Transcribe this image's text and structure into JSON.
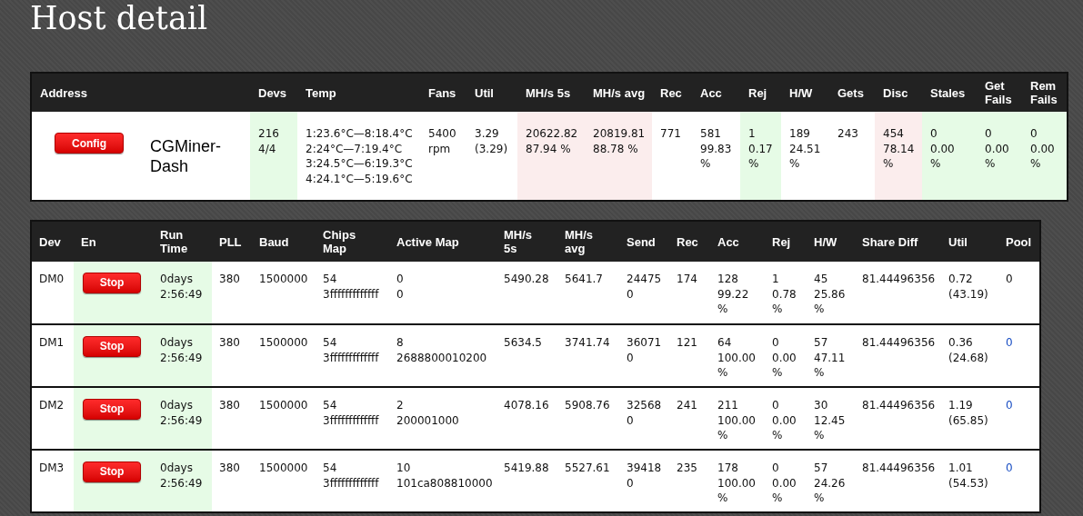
{
  "page": {
    "title": "Host detail"
  },
  "summary_table": {
    "columns": [
      "Address",
      "Devs",
      "Temp",
      "Fans",
      "Util",
      "MH/s 5s",
      "MH/s avg",
      "Rec",
      "Acc",
      "Rej",
      "H/W",
      "Gets",
      "Disc",
      "Stales",
      "Get Fails",
      "Rem Fails"
    ],
    "rows": [
      {
        "cells": [
          {
            "kind": "address",
            "button": "Config",
            "name": "CGMiner-\nDash"
          },
          {
            "kind": "text",
            "text": "216\n4/4",
            "color": "#e6fbe6"
          },
          {
            "kind": "text",
            "text": "1:23.6°C—8:18.4°C\n2:24°C—7:19.4°C\n3:24.5°C—6:19.3°C\n4:24.1°C—5:19.6°C"
          },
          {
            "kind": "text",
            "text": "5400\nrpm"
          },
          {
            "kind": "text",
            "text": "3.29\n(3.29)"
          },
          {
            "kind": "text",
            "text": "20622.82\n87.94 %",
            "color": "#fbeded"
          },
          {
            "kind": "text",
            "text": "20819.81\n88.78 %",
            "color": "#fbeded"
          },
          {
            "kind": "text",
            "text": "771"
          },
          {
            "kind": "text",
            "text": "581\n99.83\n%"
          },
          {
            "kind": "text",
            "text": "1\n0.17\n%",
            "color": "#e6fbe6"
          },
          {
            "kind": "text",
            "text": "189\n24.51\n%"
          },
          {
            "kind": "text",
            "text": "243"
          },
          {
            "kind": "text",
            "text": "454\n78.14\n%",
            "color": "#fbeded"
          },
          {
            "kind": "text",
            "text": "0\n0.00\n%",
            "color": "#e6fbe6"
          },
          {
            "kind": "text",
            "text": "0\n0.00\n%",
            "color": "#e6fbe6"
          },
          {
            "kind": "text",
            "text": "0\n0.00\n%",
            "color": "#e6fbe6"
          }
        ]
      }
    ]
  },
  "devices_table": {
    "columns": [
      "Dev",
      "En",
      "Run\nTime",
      "PLL",
      "Baud",
      "Chips\nMap",
      "Active Map",
      "MH/s\n5s",
      "MH/s\navg",
      "Send",
      "Rec",
      "Acc",
      "Rej",
      "H/W",
      "Share Diff",
      "Util",
      "Pool"
    ],
    "rows": [
      {
        "cells": [
          {
            "kind": "text",
            "text": "DM0"
          },
          {
            "kind": "button",
            "text": "Stop",
            "color": "#e6fbe6"
          },
          {
            "kind": "text",
            "text": "0days\n2:56:49",
            "color": "#e6fbe6"
          },
          {
            "kind": "text",
            "text": "380"
          },
          {
            "kind": "text",
            "text": "1500000"
          },
          {
            "kind": "text",
            "text": "54\n3fffffffffffff"
          },
          {
            "kind": "text",
            "text": "0\n0"
          },
          {
            "kind": "text",
            "text": "5490.28"
          },
          {
            "kind": "text",
            "text": "5641.7"
          },
          {
            "kind": "text",
            "text": "24475\n0"
          },
          {
            "kind": "text",
            "text": "174"
          },
          {
            "kind": "text",
            "text": "128\n99.22\n%"
          },
          {
            "kind": "text",
            "text": "1\n0.78\n%"
          },
          {
            "kind": "text",
            "text": "45\n25.86\n%"
          },
          {
            "kind": "text",
            "text": "81.44496356"
          },
          {
            "kind": "text",
            "text": "0.72\n(43.19)"
          },
          {
            "kind": "text",
            "text": "0"
          }
        ]
      },
      {
        "cells": [
          {
            "kind": "text",
            "text": "DM1"
          },
          {
            "kind": "button",
            "text": "Stop",
            "color": "#e6fbe6"
          },
          {
            "kind": "text",
            "text": "0days\n2:56:49",
            "color": "#e6fbe6"
          },
          {
            "kind": "text",
            "text": "380"
          },
          {
            "kind": "text",
            "text": "1500000"
          },
          {
            "kind": "text",
            "text": "54\n3fffffffffffff"
          },
          {
            "kind": "text",
            "text": "8\n2688800010200"
          },
          {
            "kind": "text",
            "text": "5634.5"
          },
          {
            "kind": "text",
            "text": "3741.74"
          },
          {
            "kind": "text",
            "text": "36071\n0"
          },
          {
            "kind": "text",
            "text": "121"
          },
          {
            "kind": "text",
            "text": "64\n100.00\n%"
          },
          {
            "kind": "text",
            "text": "0\n0.00\n%"
          },
          {
            "kind": "text",
            "text": "57\n47.11\n%"
          },
          {
            "kind": "text",
            "text": "81.44496356"
          },
          {
            "kind": "text",
            "text": "0.36\n(24.68)"
          },
          {
            "kind": "link",
            "text": "0"
          }
        ]
      },
      {
        "cells": [
          {
            "kind": "text",
            "text": "DM2"
          },
          {
            "kind": "button",
            "text": "Stop",
            "color": "#e6fbe6"
          },
          {
            "kind": "text",
            "text": "0days\n2:56:49",
            "color": "#e6fbe6"
          },
          {
            "kind": "text",
            "text": "380"
          },
          {
            "kind": "text",
            "text": "1500000"
          },
          {
            "kind": "text",
            "text": "54\n3fffffffffffff"
          },
          {
            "kind": "text",
            "text": "2\n200001000"
          },
          {
            "kind": "text",
            "text": "4078.16"
          },
          {
            "kind": "text",
            "text": "5908.76"
          },
          {
            "kind": "text",
            "text": "32568\n0"
          },
          {
            "kind": "text",
            "text": "241"
          },
          {
            "kind": "text",
            "text": "211\n100.00\n%"
          },
          {
            "kind": "text",
            "text": "0\n0.00\n%"
          },
          {
            "kind": "text",
            "text": "30\n12.45\n%"
          },
          {
            "kind": "text",
            "text": "81.44496356"
          },
          {
            "kind": "text",
            "text": "1.19\n(65.85)"
          },
          {
            "kind": "link",
            "text": "0"
          }
        ]
      },
      {
        "cells": [
          {
            "kind": "text",
            "text": "DM3"
          },
          {
            "kind": "button",
            "text": "Stop",
            "color": "#e6fbe6"
          },
          {
            "kind": "text",
            "text": "0days\n2:56:49",
            "color": "#e6fbe6"
          },
          {
            "kind": "text",
            "text": "380"
          },
          {
            "kind": "text",
            "text": "1500000"
          },
          {
            "kind": "text",
            "text": "54\n3fffffffffffff"
          },
          {
            "kind": "text",
            "text": "10\n101ca808810000"
          },
          {
            "kind": "text",
            "text": "5419.88"
          },
          {
            "kind": "text",
            "text": "5527.61"
          },
          {
            "kind": "text",
            "text": "39418\n0"
          },
          {
            "kind": "text",
            "text": "235"
          },
          {
            "kind": "text",
            "text": "178\n100.00\n%"
          },
          {
            "kind": "text",
            "text": "0\n0.00\n%"
          },
          {
            "kind": "text",
            "text": "57\n24.26\n%"
          },
          {
            "kind": "text",
            "text": "81.44496356"
          },
          {
            "kind": "text",
            "text": "1.01\n(54.53)"
          },
          {
            "kind": "link",
            "text": "0"
          }
        ]
      }
    ]
  }
}
